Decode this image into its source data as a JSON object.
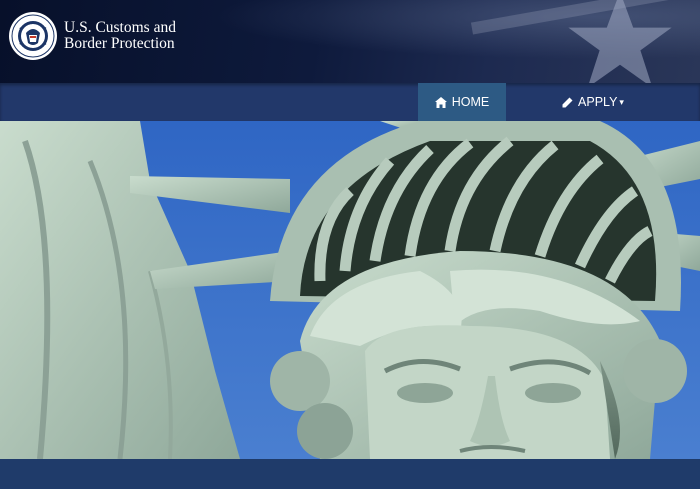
{
  "header": {
    "agency_line1": "U.S. Customs and",
    "agency_line2": "Border Protection",
    "seal_icon": "dhs-seal-icon"
  },
  "nav": {
    "home_label": "HOME",
    "home_icon": "home-icon",
    "apply_label": "APPLY",
    "apply_icon": "pencil-icon",
    "apply_caret": "▾"
  },
  "hero": {
    "image": "statue-of-liberty-crown"
  },
  "colors": {
    "nav_bg": "#22386a",
    "nav_active": "#2d5a84",
    "sky": "#3d6fc7",
    "statue": "#b6cbbd"
  }
}
